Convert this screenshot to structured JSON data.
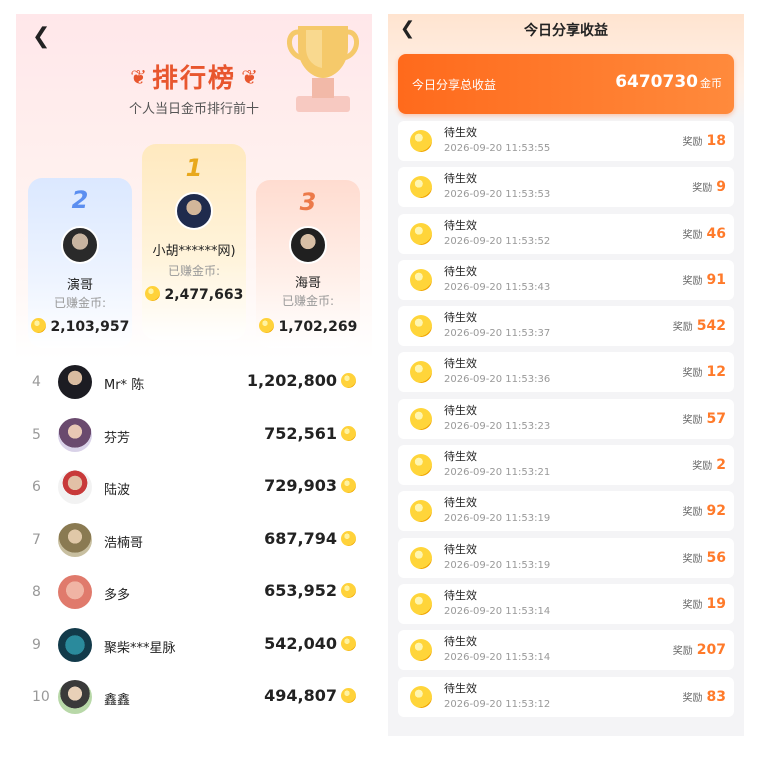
{
  "leaderboard": {
    "back_icon": "chevron-left",
    "title": "排行榜",
    "subtitle": "个人当日金币排行前十",
    "earned_label": "已赚金币:",
    "podium": [
      {
        "rank": "2",
        "name": "演哥",
        "coins": "2,103,957"
      },
      {
        "rank": "1",
        "name": "小胡******网)",
        "coins": "2,477,663"
      },
      {
        "rank": "3",
        "name": "海哥",
        "coins": "1,702,269"
      }
    ],
    "list": [
      {
        "rank": "4",
        "name": "Mr* 陈",
        "coins": "1,202,800"
      },
      {
        "rank": "5",
        "name": "芬芳",
        "coins": "752,561"
      },
      {
        "rank": "6",
        "name": "陆波",
        "coins": "729,903"
      },
      {
        "rank": "7",
        "name": "浩楠哥",
        "coins": "687,794"
      },
      {
        "rank": "8",
        "name": "多多",
        "coins": "653,952"
      },
      {
        "rank": "9",
        "name": "聚柴***星脉",
        "coins": "542,040"
      },
      {
        "rank": "10",
        "name": "鑫鑫",
        "coins": "494,807"
      }
    ],
    "colors": {
      "title": "#e8562e",
      "rank1": "#e8a81c",
      "rank2": "#5b8ef0",
      "rank3": "#ec7a4a"
    }
  },
  "share_earnings": {
    "back_icon": "chevron-left",
    "title": "今日分享收益",
    "total_label": "今日分享总收益",
    "total_value": "6470730",
    "total_unit": "金币",
    "reward_label": "奖励",
    "records": [
      {
        "status": "待生效",
        "time": "2026-09-20 11:53:55",
        "amount": "18"
      },
      {
        "status": "待生效",
        "time": "2026-09-20 11:53:53",
        "amount": "9"
      },
      {
        "status": "待生效",
        "time": "2026-09-20 11:53:52",
        "amount": "46"
      },
      {
        "status": "待生效",
        "time": "2026-09-20 11:53:43",
        "amount": "91"
      },
      {
        "status": "待生效",
        "time": "2026-09-20 11:53:37",
        "amount": "542"
      },
      {
        "status": "待生效",
        "time": "2026-09-20 11:53:36",
        "amount": "12"
      },
      {
        "status": "待生效",
        "time": "2026-09-20 11:53:23",
        "amount": "57"
      },
      {
        "status": "待生效",
        "time": "2026-09-20 11:53:21",
        "amount": "2"
      },
      {
        "status": "待生效",
        "time": "2026-09-20 11:53:19",
        "amount": "92"
      },
      {
        "status": "待生效",
        "time": "2026-09-20 11:53:19",
        "amount": "56"
      },
      {
        "status": "待生效",
        "time": "2026-09-20 11:53:14",
        "amount": "19"
      },
      {
        "status": "待生效",
        "time": "2026-09-20 11:53:14",
        "amount": "207"
      },
      {
        "status": "待生效",
        "time": "2026-09-20 11:53:12",
        "amount": "83"
      }
    ],
    "colors": {
      "accent": "#ff6a1c",
      "amount": "#ff7a2a"
    }
  }
}
